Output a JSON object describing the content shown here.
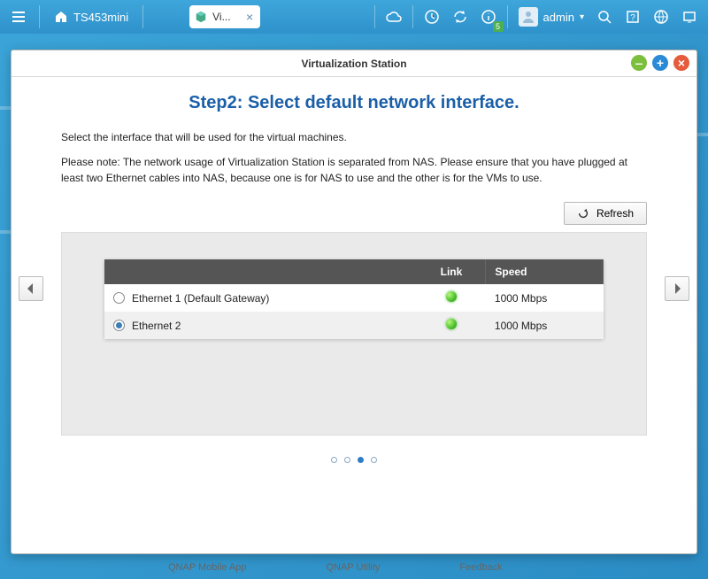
{
  "topbar": {
    "device_name": "TS453mini",
    "tab_label": "Vi...",
    "user": "admin"
  },
  "window": {
    "title": "Virtualization Station"
  },
  "wizard": {
    "heading": "Step2: Select default network interface.",
    "desc1": "Select the interface that will be used for the virtual machines.",
    "desc2": "Please note: The network usage of Virtualization Station is separated from NAS. Please ensure that you have plugged at least two Ethernet cables into NAS, because one is for NAS to use and the other is for the VMs to use.",
    "refresh_label": "Refresh",
    "columns": {
      "name": "",
      "link": "Link",
      "speed": "Speed"
    },
    "interfaces": [
      {
        "label": "Ethernet 1 (Default Gateway)",
        "selected": false,
        "link_up": true,
        "speed": "1000 Mbps"
      },
      {
        "label": "Ethernet 2",
        "selected": true,
        "link_up": true,
        "speed": "1000 Mbps"
      }
    ],
    "page_index": 2,
    "page_count": 4
  },
  "bottom": {
    "item1": "QNAP Mobile App",
    "item2": "QNAP Utility",
    "item3": "Feedback"
  }
}
